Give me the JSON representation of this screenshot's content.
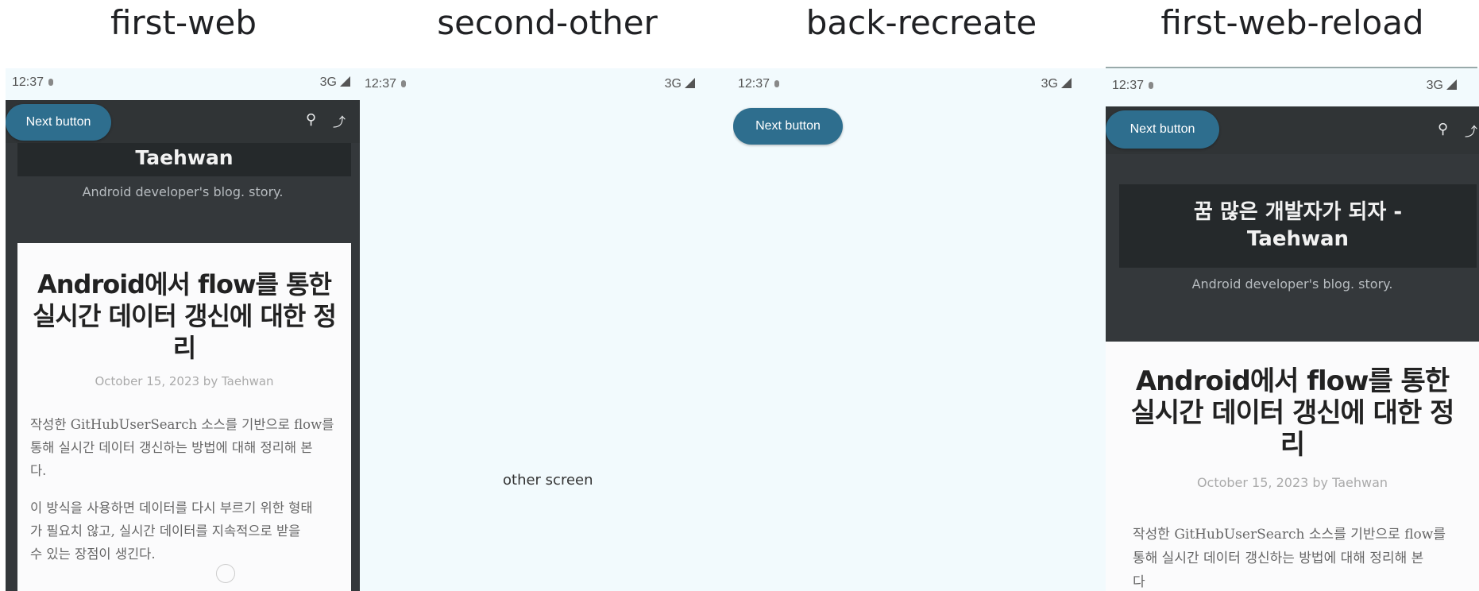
{
  "captions": [
    "first-web",
    "second-other",
    "back-recreate",
    "first-web-reload"
  ],
  "status": {
    "time": "12:37",
    "network": "3G"
  },
  "next_button_label": "Next button",
  "icons": {
    "search": "search-icon",
    "rss": "rss-icon"
  },
  "blog": {
    "title_partial": "Taehwan",
    "title_full_line1": "꿈 많은 개발자가 되자 -",
    "title_full_line2": "Taehwan",
    "tagline": "Android developer's blog. story."
  },
  "post": {
    "title_line1": "Android에서 flow를 통한",
    "title_line2": "실시간 데이터 갱신에 대한 정",
    "title_line3": "리",
    "meta": "October 15, 2023 by Taehwan",
    "para1_line1": "작성한 GitHubUserSearch 소스를 기반으로 flow를",
    "para1_line2": "통해 실시간 데이터 갱신하는 방법에 대해 정리해 본",
    "para1_line3": "다.",
    "para2_line1": "이 방식을 사용하면 데이터를 다시 부르기 위한 형태",
    "para2_line2": "가 필요치 않고, 실시간 데이터를 지속적으로 받을",
    "para2_line3": "수 있는 장점이 생긴다.",
    "para1_cut": "다"
  },
  "other_screen": "other screen",
  "colors": {
    "panel_bg": "#f2fafd",
    "appbar": "#303436",
    "button": "#2e6e8e"
  }
}
